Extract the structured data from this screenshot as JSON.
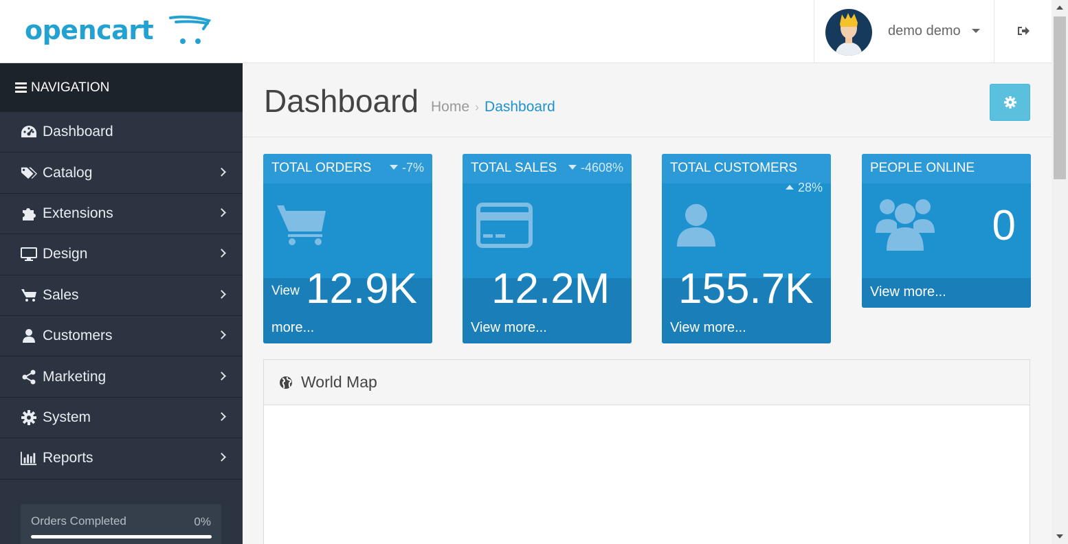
{
  "brand": {
    "logo_text": "opencart",
    "accent": "#23a1d1"
  },
  "header": {
    "user_name": "demo demo",
    "logout_icon": "sign-out-icon"
  },
  "sidebar": {
    "heading": "NAVIGATION",
    "items": [
      {
        "label": "Dashboard",
        "icon": "dashboard-icon",
        "has_submenu": false
      },
      {
        "label": "Catalog",
        "icon": "tags-icon",
        "has_submenu": true
      },
      {
        "label": "Extensions",
        "icon": "puzzle-icon",
        "has_submenu": true
      },
      {
        "label": "Design",
        "icon": "monitor-icon",
        "has_submenu": true
      },
      {
        "label": "Sales",
        "icon": "cart-icon",
        "has_submenu": true
      },
      {
        "label": "Customers",
        "icon": "user-icon",
        "has_submenu": true
      },
      {
        "label": "Marketing",
        "icon": "share-icon",
        "has_submenu": true
      },
      {
        "label": "System",
        "icon": "cog-icon",
        "has_submenu": true
      },
      {
        "label": "Reports",
        "icon": "bar-chart-icon",
        "has_submenu": true
      }
    ],
    "progress": {
      "label": "Orders Completed",
      "value_text": "0%",
      "value": 0
    }
  },
  "page": {
    "title": "Dashboard",
    "breadcrumb": {
      "home": "Home",
      "separator": "›",
      "current": "Dashboard"
    }
  },
  "tiles": [
    {
      "title": "TOTAL ORDERS",
      "change": "-7%",
      "direction": "down",
      "value": "12.9K",
      "link_word1": "View",
      "link_word2": "more..."
    },
    {
      "title": "TOTAL SALES",
      "change": "-4608%",
      "direction": "down",
      "value": "12.2M",
      "link": "View more..."
    },
    {
      "title": "TOTAL CUSTOMERS",
      "change": "28%",
      "direction": "up",
      "value": "155.7K",
      "link": "View more..."
    },
    {
      "title": "PEOPLE ONLINE",
      "value": "0",
      "link": "View more..."
    }
  ],
  "world_map": {
    "title": "World Map"
  },
  "colors": {
    "tile_bg": "#1e91cf",
    "sidebar_bg": "#2b3440",
    "settings_button": "#5bc0de"
  }
}
